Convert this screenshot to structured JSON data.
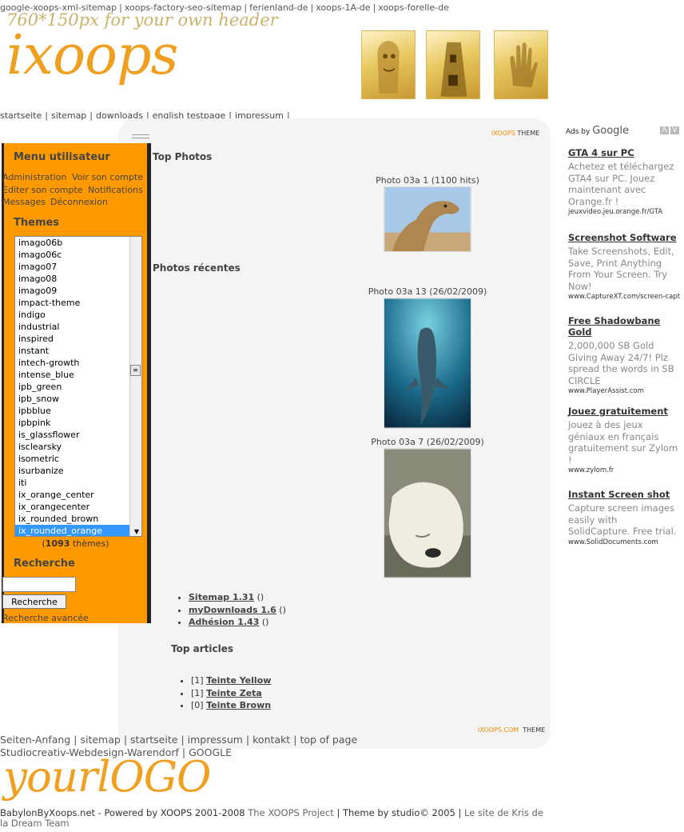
{
  "top_links": [
    "google-xoops-xml-sitemap",
    "xoops-factory-seo-sitemap",
    "ferienland-de",
    "xoops-1A-de",
    "xoops-forelle-de"
  ],
  "header": {
    "note": "760*150px for your own header",
    "logo": "ixoops"
  },
  "main_nav": [
    "startseite",
    "sitemap",
    "downloads",
    "english testpage",
    "impressum"
  ],
  "brand": {
    "xoops": "IXOOPS",
    "theme": "THEME",
    "xoops_com": "IXOOPS.COM",
    "theme2": "THEME"
  },
  "sidebar": {
    "user_menu_title": "Menu utilisateur",
    "user_links": [
      "Administration",
      "Voir son compte",
      "Editer son compte",
      "Notifications",
      "Messages",
      "Déconnexion"
    ],
    "themes_title": "Themes",
    "themes": [
      "imago06b",
      "imago06c",
      "imago07",
      "imago08",
      "imago09",
      "impact-theme",
      "indigo",
      "industrial",
      "inspired",
      "instant",
      "intech-growth",
      "intense_blue",
      "ipb_green",
      "ipb_snow",
      "ipbblue",
      "ipbpink",
      "is_glassflower",
      "isclearsky",
      "isometric",
      "isurbanize",
      "iti",
      "ix_orange_center",
      "ix_orangecenter",
      "ix_rounded_brown",
      "ix_rounded_orange"
    ],
    "selected_theme": "ix_rounded_orange",
    "theme_count_prefix": "(",
    "theme_count": "1093",
    "theme_count_suffix": " thèmes)",
    "search_title": "Recherche",
    "search_value": "",
    "search_button": "Recherche",
    "advanced_search": "Recherche avancée"
  },
  "content": {
    "top_photos_title": "Top Photos",
    "top_photo_caption": "Photo 03a 1 (1100 hits)",
    "recent_title": "Photos récentes",
    "recent_captions": [
      "Photo 03a 13 (26/02/2009)",
      "Photo 03a 7 (26/02/2009)"
    ],
    "modules": [
      {
        "name": "Sitemap 1.31",
        "suffix": " ()"
      },
      {
        "name": "myDownloads 1.6",
        "suffix": " ()"
      },
      {
        "name": "Adhésion 1.43",
        "suffix": " ()"
      }
    ],
    "top_articles_title": "Top articles",
    "articles": [
      {
        "count": "[1] ",
        "name": "Teinte Yellow"
      },
      {
        "count": "[1] ",
        "name": "Teinte Zeta"
      },
      {
        "count": "[0] ",
        "name": "Teinte Brown"
      }
    ]
  },
  "ads": {
    "ads_by": "Ads by",
    "google": "Google",
    "items": [
      {
        "title": "GTA 4 sur PC",
        "body": "Achetez et téléchargez GTA4 sur PC. Jouez maintenant avec Orange.fr !",
        "url": "jeuxvideo.jeu.orange.fr/GTA"
      },
      {
        "title": "Screenshot Software",
        "body": "Take Screenshots, Edit, Save, Print Anything From Your Screen. Try Now!",
        "url": "www.CaptureXT.com/screen-capt"
      },
      {
        "title": "Free Shadowbane Gold",
        "body": "2,000,000 SB Gold Giving Away 24/7! Plz spread the words in SB CIRCLE",
        "url": "www.PlayerAssist.com"
      },
      {
        "title": "Jouez gratuitement",
        "body": "Jouez à des jeux géniaux en français gratuitement sur Zylom !",
        "url": "www.zylom.fr"
      },
      {
        "title": "Instant Screen shot",
        "body": "Capture screen images easily with SolidCapture. Free trial.",
        "url": "www.SolidDocuments.com"
      }
    ]
  },
  "footer": {
    "nav": [
      "Seiten-Anfang",
      "sitemap",
      "startseite",
      "impressum",
      "kontakt",
      "top of page"
    ],
    "credit": [
      "Studiocreativ-Webdesign-Warendorf",
      "GOOGLE"
    ],
    "logo": "yourlOGO",
    "copy_1": "BabylonByXoops.net - Powered by XOOPS 2001-2008 ",
    "copy_2": "The XOOPS Project",
    "copy_3": " | Theme by studio© 2005 | ",
    "copy_4": "Le site de Kris",
    "copy_5": " de la Dream Team"
  }
}
